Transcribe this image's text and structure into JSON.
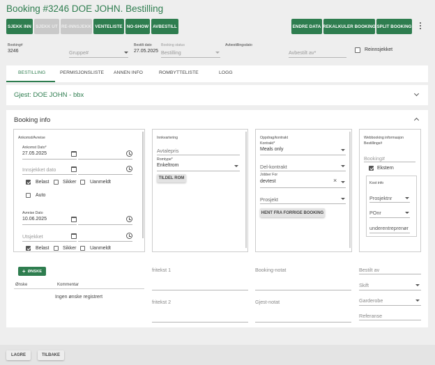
{
  "title": "Booking #3246 DOE JOHN. Bestilling",
  "buttons": {
    "sjekk_inn": "SJEKK INN",
    "sjekk_ut": "SJEKK UT",
    "re_innsjekk": "RE-INNSJEKK",
    "venteliste": "VENTELISTE",
    "no_show": "NO-SHOW",
    "avbestill": "AVBESTILL",
    "endre_data": "ENDRE DATA",
    "rekalkuler": "REKALKULER BOOKING",
    "split": "SPLIT BOOKING"
  },
  "header_fields": {
    "booking_label": "Booking#",
    "booking_value": "3246",
    "gruppe_placeholder": "Gruppe#",
    "bestilt_label": "Bestilt dato",
    "bestilt_value": "27.05.2025",
    "status_label": "Booking status",
    "status_value": "Bestilling",
    "avbest_label": "Avbestillingsdato",
    "avbest_by": "Avbestilt av*",
    "reinnsjekket": "Reinnsjekket"
  },
  "tabs": [
    "BESTILLING",
    "PERMISJONSLISTE",
    "ANNEN INFO",
    "ROMBYTTELISTE",
    "LOGG"
  ],
  "guest": "Gjest: DOE JOHN - bbx",
  "booking_info_title": "Booking info",
  "arrival": {
    "heading": "Ankomst/Avreise",
    "ankomst_label": "Ankomst Dato*",
    "ankomst_value": "27.05.2025",
    "innsjekket_placeholder": "Innsjekket dato",
    "belast": "Belast",
    "sikker": "Sikker",
    "uanmeldt": "Uanmeldt",
    "auto": "Auto",
    "avreise_label": "Avreise Dato",
    "avreise_value": "10.06.2025",
    "utsjekket_placeholder": "Utsjekket"
  },
  "room": {
    "heading": "Innkvartering",
    "avtalepris": "Avtalepris",
    "romtype_label": "Romtype*",
    "romtype_value": "Enkeltrom",
    "tildel": "TILDEL ROM"
  },
  "assignment": {
    "heading": "Oppdrag/kontrakt",
    "kontrakt_label": "Kontrakt*",
    "kontrakt_value": "Meals only",
    "del_kontrakt": "Del-kontrakt",
    "jobber_label": "Jobber For",
    "jobber_value": "devtest",
    "prosjekt": "Prosjekt",
    "hent": "HENT FRA FORRIGE BOOKING"
  },
  "web": {
    "heading": "Webbooking informasjon",
    "bestillings_label": "Bestillings#",
    "booking_placeholder": "Booking#",
    "ekstern": "Ekstern",
    "kost_info": "Kost info",
    "prosjektnr": "Prosjektnr",
    "ponr": "POnr",
    "underentreprenor": "underentreprenør"
  },
  "wishes": {
    "add": "ØNSKE",
    "col_onske": "Ønske",
    "col_kommentar": "Kommentar",
    "empty": "Ingen ønske registrert"
  },
  "bottom_fields": {
    "fritekst1": "fritekst 1",
    "fritekst2": "fritekst 2",
    "booking_notat": "Booking-notat",
    "gjest_notat": "Gjest-notat",
    "bestilt_av": "Bestilt av",
    "skift": "Skift",
    "garderobe": "Garderobe",
    "referanse": "Referanse"
  },
  "footer": {
    "lagre": "LAGRE",
    "tilbake": "TILBAKE"
  },
  "colors": {
    "accent": "#2e7d4f",
    "disabled": "#c9c9c9",
    "background": "#eeeeee"
  }
}
